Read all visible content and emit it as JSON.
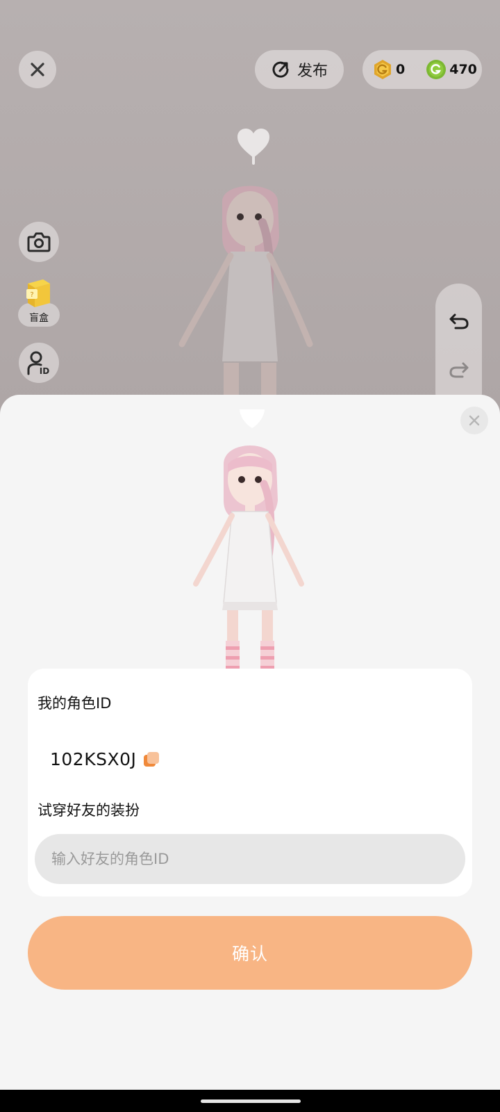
{
  "toolbar": {
    "publish_label": "发布",
    "currency_gold": "0",
    "currency_green": "470"
  },
  "side_tools": {
    "blindbox_label": "盲盒"
  },
  "sheet": {
    "my_id_label": "我的角色ID",
    "my_id_value": "102KSX0J",
    "tryon_label": "试穿好友的装扮",
    "friend_id_placeholder": "输入好友的角色ID",
    "friend_id_value": "",
    "confirm_label": "确认"
  },
  "colors": {
    "accent": "#f8b584",
    "gold_coin": "#e0a52a",
    "green_coin": "#7cb832",
    "copy_icon": "#f0893a"
  }
}
